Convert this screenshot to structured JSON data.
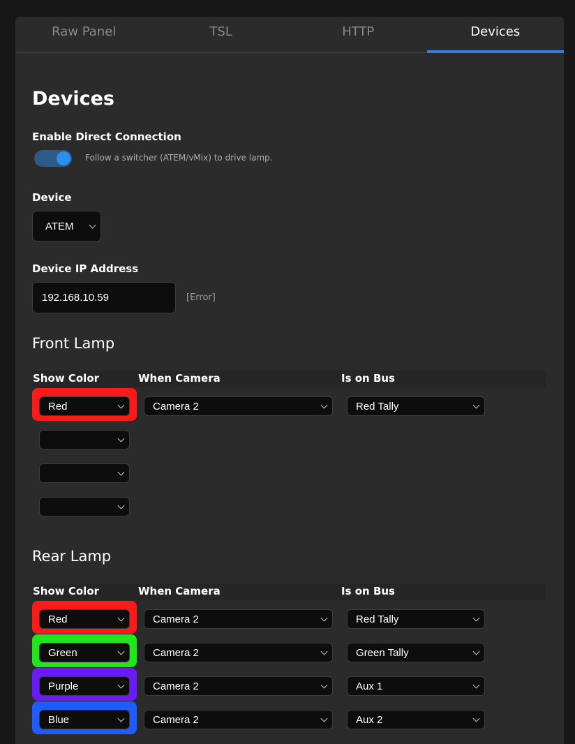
{
  "tabs": [
    "Raw Panel",
    "TSL",
    "HTTP",
    "Devices"
  ],
  "page_title": "Devices",
  "direct_connection": {
    "label": "Enable Direct Connection",
    "hint": "Follow a switcher (ATEM/vMix) to drive lamp.",
    "enabled": true
  },
  "device": {
    "label": "Device",
    "value": "ATEM"
  },
  "ip": {
    "label": "Device IP Address",
    "value": "192.168.10.59",
    "status": "[Error]"
  },
  "table_headers": {
    "show_color": "Show Color",
    "when_camera": "When Camera",
    "is_on_bus": "Is on Bus"
  },
  "front_lamp": {
    "title": "Front Lamp",
    "rows": [
      {
        "color": "Red",
        "camera": "Camera 2",
        "bus": "Red Tally",
        "ring": "#ff1a1a"
      },
      {
        "color": "",
        "camera": "",
        "bus": ""
      },
      {
        "color": "",
        "camera": "",
        "bus": ""
      },
      {
        "color": "",
        "camera": "",
        "bus": ""
      }
    ]
  },
  "rear_lamp": {
    "title": "Rear Lamp",
    "rows": [
      {
        "color": "Red",
        "camera": "Camera 2",
        "bus": "Red Tally",
        "ring": "#ff1a1a"
      },
      {
        "color": "Green",
        "camera": "Camera 2",
        "bus": "Green Tally",
        "ring": "#22e61c"
      },
      {
        "color": "Purple",
        "camera": "Camera 2",
        "bus": "Aux 1",
        "ring": "#6a1aff"
      },
      {
        "color": "Blue",
        "camera": "Camera 2",
        "bus": "Aux 2",
        "ring": "#1f5cff"
      }
    ]
  }
}
